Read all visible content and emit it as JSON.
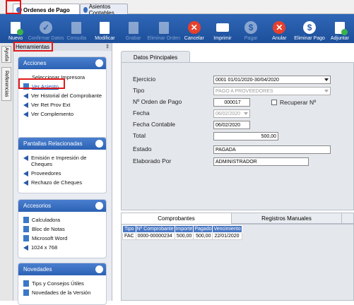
{
  "tabs": [
    {
      "label": "Ordenes de Pago"
    },
    {
      "label": "Asientos Contables"
    }
  ],
  "toolbar": {
    "nuevo": "Nuevo",
    "confirmar": "Confirmar Datos",
    "consulta": "Consulta",
    "modificar": "Modificar",
    "grabar": "Grabar",
    "eliminar_orden": "Eliminar Orden",
    "cancelar": "Cancelar",
    "imprimir": "Imprimir",
    "pagar": "Pagar",
    "anular": "Anular",
    "eliminar_pago": "Eliminar Pago",
    "adjuntar": "Adjuntar"
  },
  "side_tabs": {
    "ayuda": "Ayuda",
    "referencias": "Referencias"
  },
  "sidebar": {
    "title": "Herramientas",
    "pin": "↕",
    "acciones": {
      "title": "Acciones",
      "items": [
        "Seleccionar Impresora",
        "Ver Asiento",
        "Ver Historial del Comprobante",
        "Ver Ret Prov Ext",
        "Ver Complemento"
      ]
    },
    "pantallas": {
      "title": "Pantallas Relacionadas",
      "items": [
        "Emisión e Impresión de Cheques",
        "Proveedores",
        "Rechazo de Cheques"
      ]
    },
    "accesorios": {
      "title": "Accesorios",
      "items": [
        "Calculadora",
        "Bloc de Notas",
        "Microsoft Word",
        "1024 x 768"
      ]
    },
    "novedades": {
      "title": "Novedades",
      "items": [
        "Tips y Consejos Útiles",
        "Novedades de la Versión"
      ]
    }
  },
  "form": {
    "tab": "Datos Principales",
    "ejercicio_label": "Ejercicio",
    "ejercicio": "0001 01/01/2020-30/04/2020",
    "tipo_label": "Tipo",
    "tipo": "PAGO A PROVEEDORES",
    "orden_label": "Nº Orden de Pago",
    "orden": "000017",
    "recuperar": "Recuperar Nº",
    "fecha_label": "Fecha",
    "fecha": "06/02/2020",
    "fecha_contable_label": "Fecha Contable",
    "fecha_contable": "06/02/2020",
    "total_label": "Total",
    "total": "500,00",
    "estado_label": "Estado",
    "estado": "PAGADA",
    "elaborado_label": "Elaborado Por",
    "elaborado": "ADMINISTRADOR"
  },
  "bottom_tabs": {
    "comprobantes": "Comprobantes",
    "registros": "Registros Manuales"
  },
  "table": {
    "headers": [
      "Tipo",
      "Nº Comprobante",
      "Importe",
      "Pagado",
      "Vencimiento"
    ],
    "rows": [
      [
        "FAC",
        "0000-00000234",
        "500,00",
        "500,00",
        "22/01/2020"
      ]
    ]
  },
  "colors": {
    "toolbar": "#2f67b7",
    "panel_header": "#3a70c2",
    "highlight": "#e01a1a"
  }
}
